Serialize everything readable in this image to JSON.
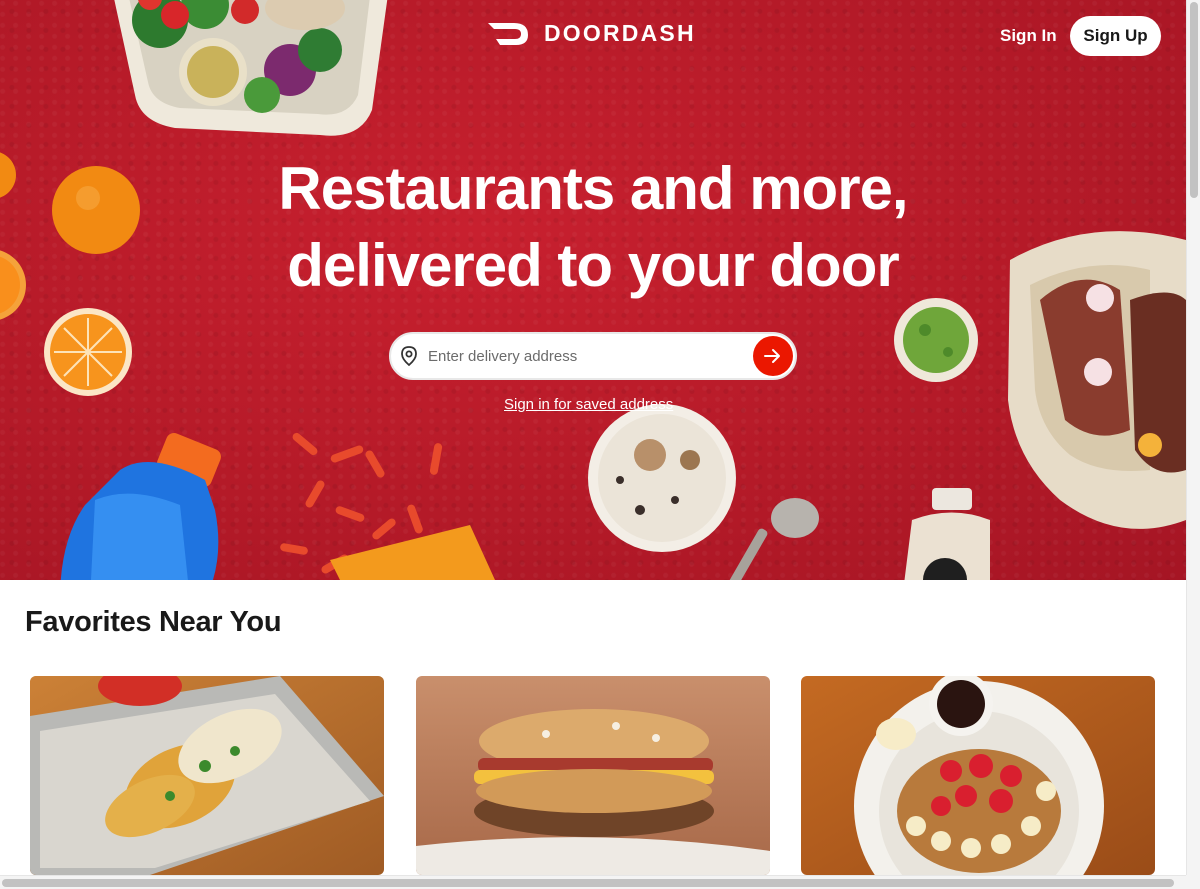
{
  "header": {
    "logo_text": "DOORDASH",
    "sign_in": "Sign In",
    "sign_up": "Sign Up"
  },
  "hero": {
    "headline_line1": "Restaurants and more,",
    "headline_line2": "delivered to your door",
    "address_placeholder": "Enter delivery address",
    "saved_address_link": "Sign in for saved address"
  },
  "favorites": {
    "title": "Favorites Near You",
    "cards": [
      {
        "image": "grilled-corn-photo"
      },
      {
        "image": "bagel-sandwich-photo"
      },
      {
        "image": "pancakes-photo"
      }
    ]
  },
  "colors": {
    "brand_red": "#eb1700",
    "hero_background": "#b51a28"
  }
}
